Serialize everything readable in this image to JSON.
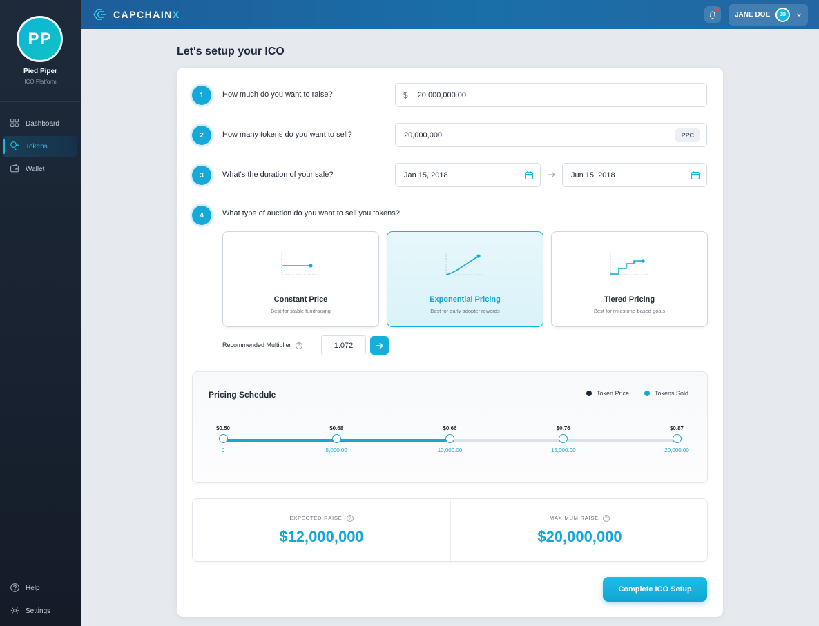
{
  "sidebar": {
    "avatar_initials": "PP",
    "org_name": "Pied Piper",
    "org_sub": "ICO Platform",
    "nav": [
      {
        "label": "Dashboard",
        "icon": "grid-icon",
        "active": false
      },
      {
        "label": "Tokens",
        "icon": "coins-icon",
        "active": true
      },
      {
        "label": "Wallet",
        "icon": "wallet-icon",
        "active": false
      }
    ],
    "footer": [
      {
        "label": "Help",
        "icon": "help-circle-icon"
      },
      {
        "label": "Settings",
        "icon": "gear-icon"
      }
    ]
  },
  "topbar": {
    "logo_main": "CAPCHAIN",
    "logo_accent": "X",
    "user_name": "JANE DOE",
    "user_initials": "JD"
  },
  "page": {
    "title": "Let's setup your ICO"
  },
  "steps": {
    "s1": {
      "num": "1",
      "question": "How much do you want to raise?",
      "prefix": "$",
      "value": "20,000,000.00"
    },
    "s2": {
      "num": "2",
      "question": "How many tokens do you want to sell?",
      "value": "20,000,000",
      "suffix": "PPC"
    },
    "s3": {
      "num": "3",
      "question": "What's the duration of your sale?",
      "start": "Jan 15, 2018",
      "end": "Jun 15, 2018"
    },
    "s4": {
      "num": "4",
      "question": "What type of auction do you want to sell you tokens?"
    }
  },
  "auctions": [
    {
      "title": "Constant Price",
      "sub": "Best for stable fundraising",
      "selected": false
    },
    {
      "title": "Exponential Pricing",
      "sub": "Best for early adopter rewards",
      "selected": true
    },
    {
      "title": "Tiered Pricing",
      "sub": "Best for milestone-based goals",
      "selected": false
    }
  ],
  "multiplier": {
    "label": "Recommended Multiplier",
    "value": "1.072"
  },
  "schedule": {
    "title": "Pricing Schedule",
    "legend_price": "Token Price",
    "legend_sold": "Tokens Sold",
    "points": [
      {
        "price": "$0.50",
        "sold": "0"
      },
      {
        "price": "$0.68",
        "sold": "5,000.00"
      },
      {
        "price": "$0.66",
        "sold": "10,000.00"
      },
      {
        "price": "$0.76",
        "sold": "15,000.00"
      },
      {
        "price": "$0.87",
        "sold": "20,000.00"
      }
    ],
    "progress": 0.5
  },
  "raise": {
    "expected_label": "EXPECTED RAISE",
    "expected_value": "$12,000,000",
    "max_label": "MAXIMUM RAISE",
    "max_value": "$20,000,000"
  },
  "cta": {
    "complete_label": "Complete ICO Setup"
  },
  "colors": {
    "accent": "#14a9d9",
    "topbar": "#1a6fa9",
    "sidebar": "#1e2a3b"
  }
}
